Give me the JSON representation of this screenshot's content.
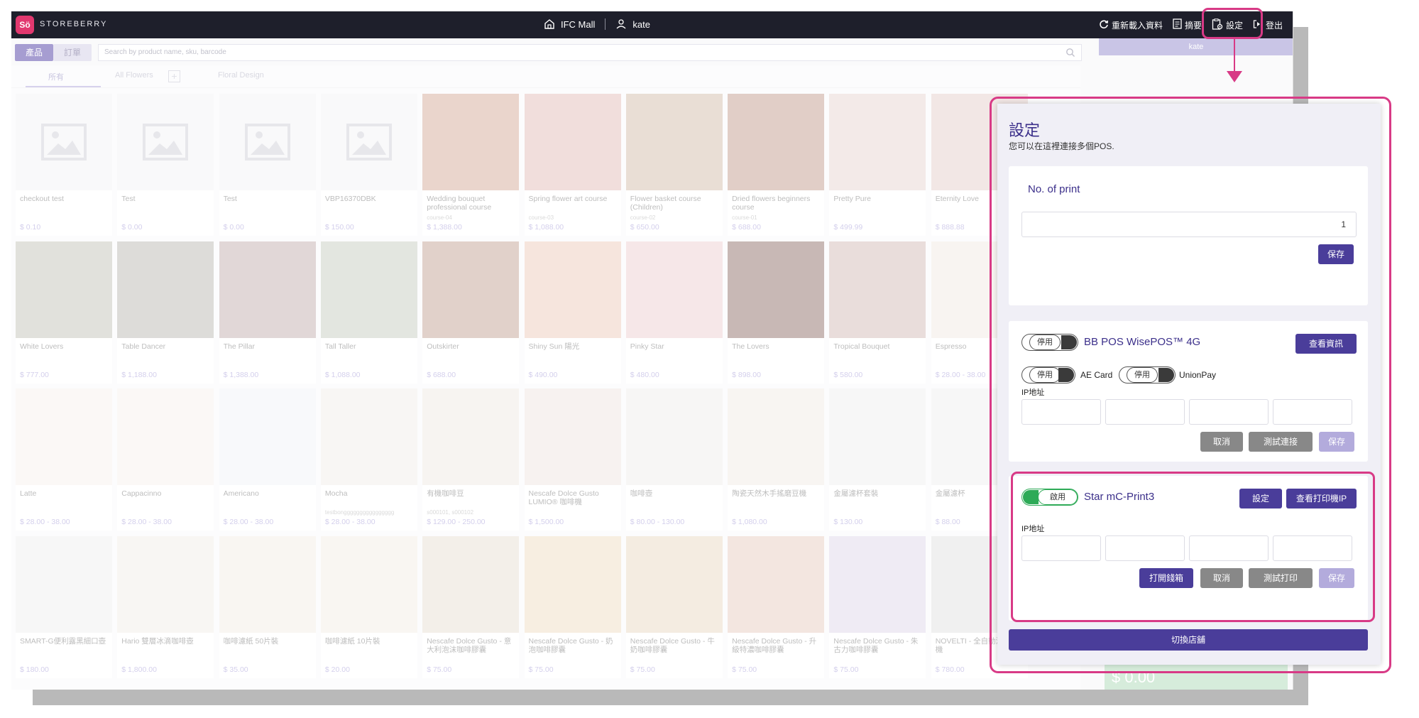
{
  "topbar": {
    "logo": "Sö",
    "brand": "STOREBERRY",
    "store_name": "IFC Mall",
    "user_name": "kate",
    "reload_label": "重新載入資料",
    "summary_label": "摘要",
    "settings_label": "設定",
    "logout_label": "登出"
  },
  "search": {
    "products_tab": "產品",
    "orders_tab": "訂單",
    "placeholder": "Search by product name, sku, barcode"
  },
  "categories": {
    "all": "所有",
    "all_flowers": "All Flowers",
    "add": "+",
    "floral_design": "Floral Design"
  },
  "products": [
    {
      "name": "checkout test",
      "sku": "",
      "price": "$ 0.10",
      "color": "#f4f4f6",
      "placeholder": true
    },
    {
      "name": "Test",
      "sku": "",
      "price": "$ 0.00",
      "color": "#f4f4f6",
      "placeholder": true
    },
    {
      "name": "Test",
      "sku": "",
      "price": "$ 0.00",
      "color": "#f4f4f6",
      "placeholder": true
    },
    {
      "name": "VBP16370DBK",
      "sku": "",
      "price": "$ 150.00",
      "color": "#f4f4f6",
      "placeholder": true
    },
    {
      "name": "Wedding bouquet professional course",
      "sku": "course-04",
      "price": "$ 1,388.00",
      "color": "#d9b3a3"
    },
    {
      "name": "Spring flower art course",
      "sku": "course-03",
      "price": "$ 1,088.00",
      "color": "#e6c4c0"
    },
    {
      "name": "Flower basket course (Children)",
      "sku": "course-02",
      "price": "$ 650.00",
      "color": "#d8c3b3"
    },
    {
      "name": "Dried flowers beginners course",
      "sku": "course-01",
      "price": "$ 688.00",
      "color": "#c9a79a"
    },
    {
      "name": "Pretty Pure",
      "sku": "",
      "price": "$ 499.99",
      "color": "#ead9d6"
    },
    {
      "name": "Eternity Love",
      "sku": "",
      "price": "$ 888.88",
      "color": "#e7d3d0"
    },
    {
      "name": "White Lovers",
      "sku": "",
      "price": "$ 777.00",
      "color": "#c8c9bf"
    },
    {
      "name": "Table Dancer",
      "sku": "",
      "price": "$ 1,188.00",
      "color": "#c2c0bb"
    },
    {
      "name": "The Pillar",
      "sku": "",
      "price": "$ 1,388.00",
      "color": "#c9b7b7"
    },
    {
      "name": "Tall Taller",
      "sku": "",
      "price": "$ 1,088.00",
      "color": "#cdd1c7"
    },
    {
      "name": "Outskirter",
      "sku": "",
      "price": "$ 688.00",
      "color": "#c9ab9f"
    },
    {
      "name": "Shiny Sun 陽光",
      "sku": "",
      "price": "$ 490.00",
      "color": "#efcfc2"
    },
    {
      "name": "Pinky Star",
      "sku": "",
      "price": "$ 480.00",
      "color": "#efd3d6"
    },
    {
      "name": "The Lovers",
      "sku": "",
      "price": "$ 898.00",
      "color": "#9c7e79"
    },
    {
      "name": "Tropical Bouquet",
      "sku": "",
      "price": "$ 580.00",
      "color": "#d8c2bd"
    },
    {
      "name": "Espresso",
      "sku": "",
      "price": "$ 28.00 - 38.00",
      "color": "#f2ece6"
    },
    {
      "name": "Latte",
      "sku": "",
      "price": "$ 28.00 - 38.00",
      "color": "#f7f3ef"
    },
    {
      "name": "Cappacinno",
      "sku": "",
      "price": "$ 28.00 - 38.00",
      "color": "#f7f3ef"
    },
    {
      "name": "Americano",
      "sku": "",
      "price": "$ 28.00 - 38.00",
      "color": "#f3f5f7"
    },
    {
      "name": "Mocha",
      "sku": "testbongggggggggggggggg",
      "price": "$ 28.00 - 38.00",
      "color": "#f2efeb"
    },
    {
      "name": "有機咖啡豆",
      "sku": "s000101, s000102",
      "price": "$ 129.00 - 250.00",
      "color": "#f1ece6"
    },
    {
      "name": "Nescafe Dolce Gusto LUMIO® 咖啡機",
      "sku": "",
      "price": "$ 1,500.00",
      "color": "#f0e8e4"
    },
    {
      "name": "咖啡壺",
      "sku": "",
      "price": "$ 80.00 - 130.00",
      "color": "#f0efed"
    },
    {
      "name": "陶瓷天然木手搖磨豆機",
      "sku": "",
      "price": "$ 1,080.00",
      "color": "#f2ede7"
    },
    {
      "name": "金屬濾杯套裝",
      "sku": "",
      "price": "$ 130.00",
      "color": "#f0f0f0"
    },
    {
      "name": "金屬濾杯",
      "sku": "",
      "price": "$ 88.00",
      "color": "#f0f0f0"
    },
    {
      "name": "SMART-G便利露黑細口壺",
      "sku": "",
      "price": "$ 180.00",
      "color": "#f1f1f1"
    },
    {
      "name": "Hario 雙層冰滴咖啡壺",
      "sku": "",
      "price": "$ 1,800.00",
      "color": "#f3efe9"
    },
    {
      "name": "咖啡濾紙 50片裝",
      "sku": "",
      "price": "$ 35.00",
      "color": "#f5efe7"
    },
    {
      "name": "咖啡濾紙 10片裝",
      "sku": "",
      "price": "$ 20.00",
      "color": "#f5efe7"
    },
    {
      "name": "Nescafe Dolce Gusto - 意大利泡沫咖啡膠囊",
      "sku": "",
      "price": "$ 75.00",
      "color": "#e9e2d8"
    },
    {
      "name": "Nescafe Dolce Gusto - 奶泡咖啡膠囊",
      "sku": "",
      "price": "$ 75.00",
      "color": "#f0e0c9"
    },
    {
      "name": "Nescafe Dolce Gusto - 牛奶咖啡膠囊",
      "sku": "",
      "price": "$ 75.00",
      "color": "#ecdcc8"
    },
    {
      "name": "Nescafe Dolce Gusto - 升級特濃咖啡膠囊",
      "sku": "",
      "price": "$ 75.00",
      "color": "#e9d2c6"
    },
    {
      "name": "Nescafe Dolce Gusto - 朱古力咖啡膠囊",
      "sku": "",
      "price": "$ 75.00",
      "color": "#e2dbeb"
    },
    {
      "name": "NOVELTI - 全自動沖泡咖啡機",
      "sku": "",
      "price": "$ 780.00",
      "color": "#e4e4e4"
    }
  ],
  "sidebar": {
    "user": "kate",
    "total": "$ 0.00"
  },
  "settings_panel": {
    "title": "設定",
    "subtitle": "您可以在這裡連接多個POS.",
    "print": {
      "label": "No. of print",
      "value": "1",
      "save": "保存"
    },
    "bbpos": {
      "toggle": "停用",
      "name": "BB POS WisePOS™ 4G",
      "info_button": "查看資訊",
      "ae_toggle": "停用",
      "ae_label": "AE Card",
      "up_toggle": "停用",
      "up_label": "UnionPay",
      "ip_label": "IP地址",
      "cancel": "取消",
      "test": "測試連接",
      "save": "保存"
    },
    "star": {
      "toggle": "啟用",
      "name": "Star mC-Print3",
      "settings": "設定",
      "view_ip": "查看打印機IP",
      "ip_label": "IP地址",
      "open_drawer": "打開錢箱",
      "cancel": "取消",
      "test_print": "測試打印",
      "save": "保存"
    },
    "switch_store": "切換店舖"
  }
}
